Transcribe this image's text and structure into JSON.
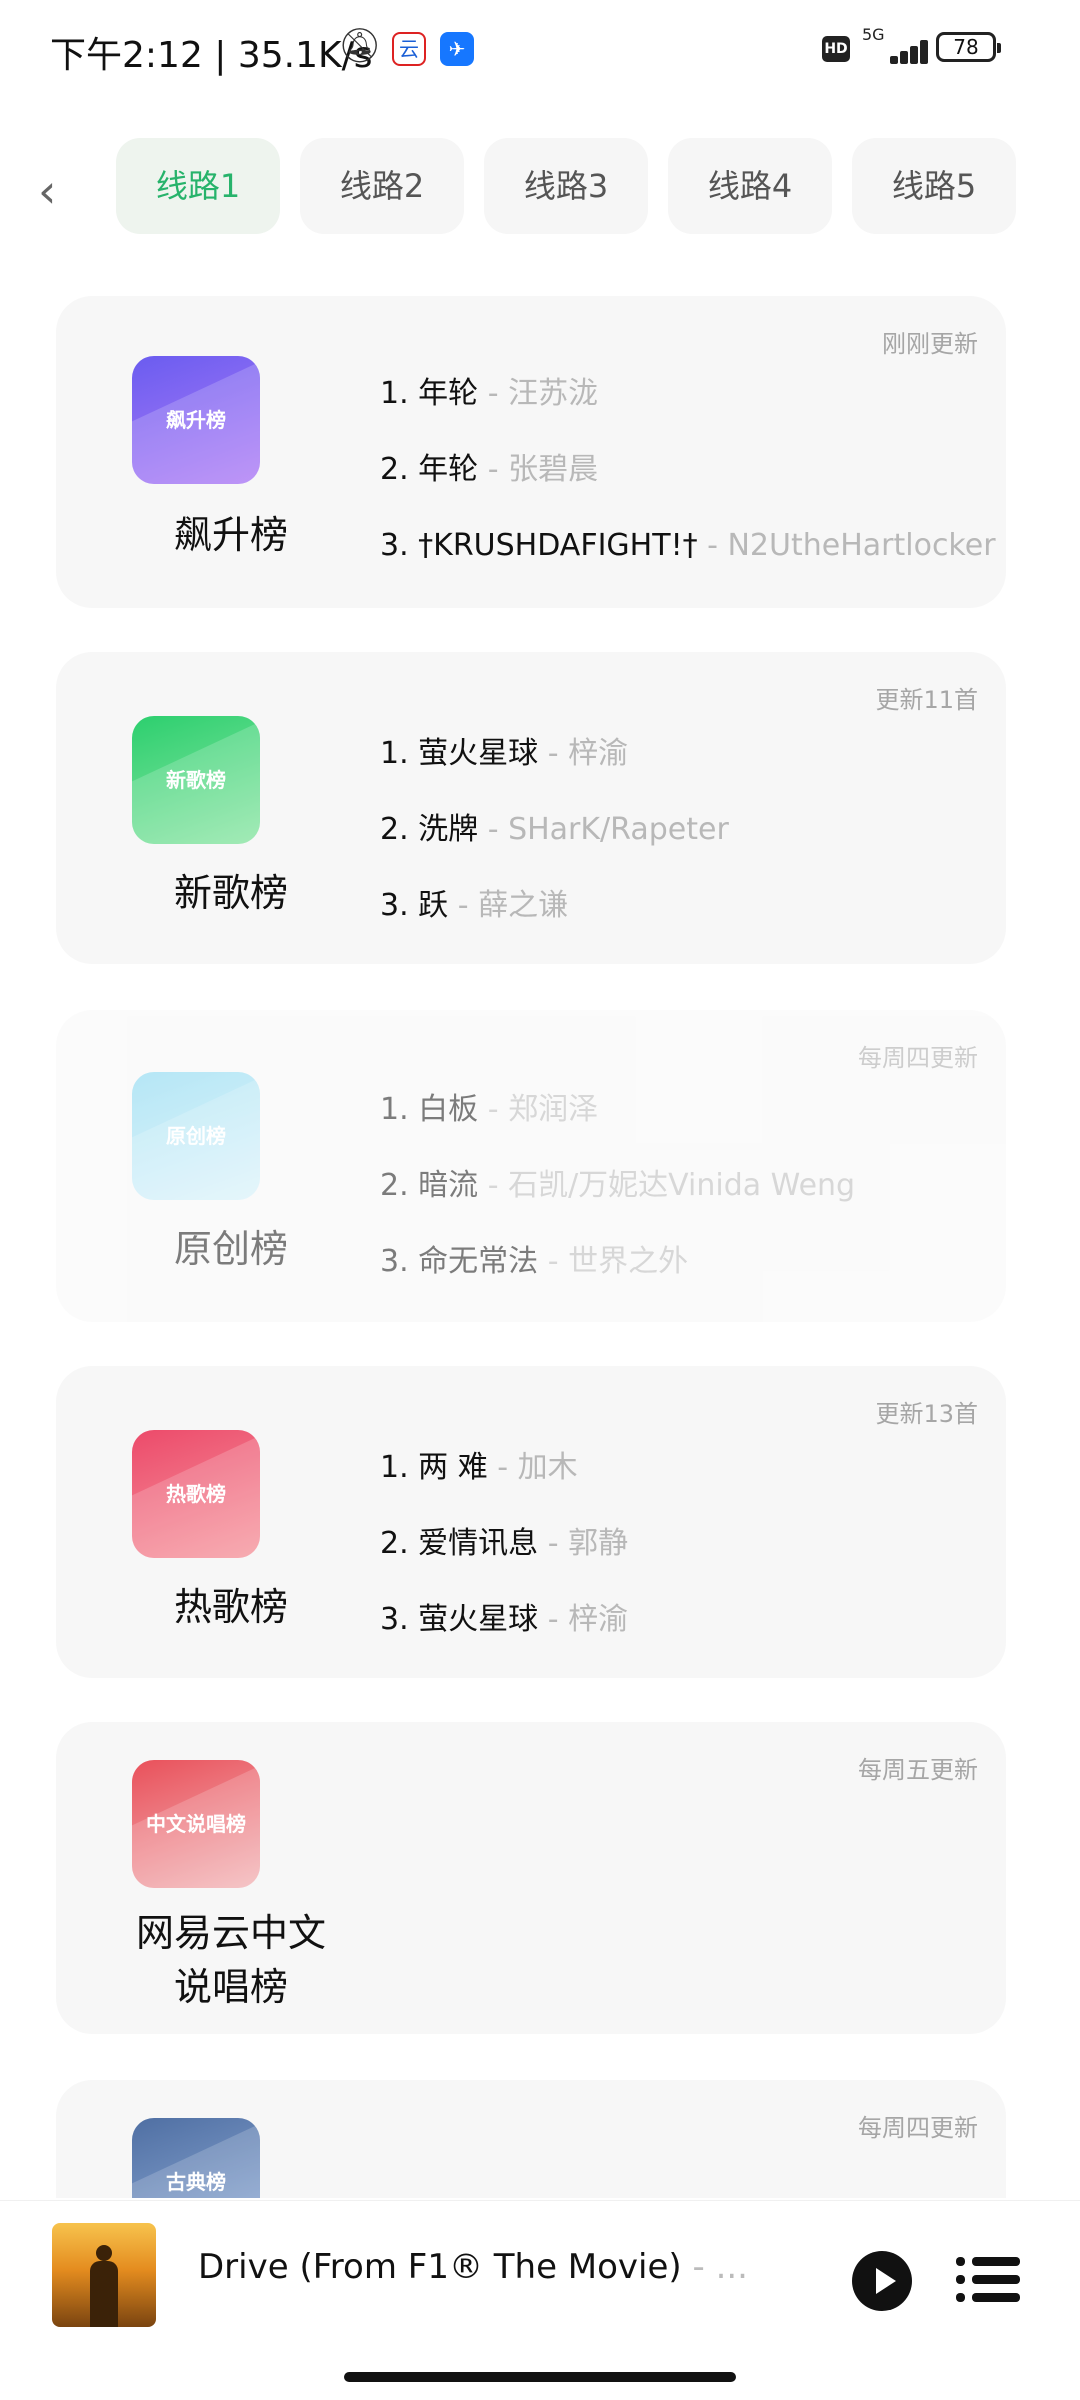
{
  "status_bar": {
    "time": "下午2:12 | 35.1K/s",
    "hd": "HD",
    "network": "5G",
    "battery": "78"
  },
  "tabs": [
    {
      "label": "线路1",
      "active": true
    },
    {
      "label": "线路2",
      "active": false
    },
    {
      "label": "线路3",
      "active": false
    },
    {
      "label": "线路4",
      "active": false
    },
    {
      "label": "线路5",
      "active": false
    }
  ],
  "charts": [
    {
      "name": "飙升榜",
      "cover_label": "飙升榜",
      "update": "刚刚更新",
      "cover_colors": [
        "#6a5cf0",
        "#b07ef6"
      ],
      "songs": [
        {
          "title": "1. 年轮",
          "artist": " - 汪苏泷"
        },
        {
          "title": "2. 年轮",
          "artist": " - 张碧晨"
        },
        {
          "title": "3. †KRUSHDAFIGHT!†",
          "artist": " - N2UtheHartlocker"
        }
      ]
    },
    {
      "name": "新歌榜",
      "cover_label": "新歌榜",
      "update": "更新11首",
      "cover_colors": [
        "#2ccf6e",
        "#8fe6a7"
      ],
      "songs": [
        {
          "title": "1. 萤火星球",
          "artist": " - 梓渝"
        },
        {
          "title": "2. 洗牌",
          "artist": " - SHarK/Rapeter"
        },
        {
          "title": "3. 跃",
          "artist": " - 薛之谦"
        }
      ]
    },
    {
      "name": "原创榜",
      "cover_label": "原创榜",
      "update": "每周四更新",
      "cover_colors": [
        "#79d3ef",
        "#c7ecf7"
      ],
      "songs": [
        {
          "title": "1. 白板",
          "artist": " - 郑润泽"
        },
        {
          "title": "2. 暗流",
          "artist": " - 石凯/万妮达Vinida Weng"
        },
        {
          "title": "3. 命无常法",
          "artist": " - 世界之外"
        }
      ]
    },
    {
      "name": "热歌榜",
      "cover_label": "热歌榜",
      "update": "更新13首",
      "cover_colors": [
        "#ec4a6a",
        "#f69aa1"
      ],
      "songs": [
        {
          "title": "1. 两 难",
          "artist": " - 加木"
        },
        {
          "title": "2. 爱情讯息",
          "artist": " - 郭静"
        },
        {
          "title": "3. 萤火星球",
          "artist": " - 梓渝"
        }
      ]
    },
    {
      "name": "网易云中文\n说唱榜",
      "cover_label": "中文说唱榜",
      "update": "每周五更新",
      "cover_colors": [
        "#e9505a",
        "#f3b9bb"
      ],
      "songs": []
    },
    {
      "name": "",
      "cover_label": "古典榜",
      "update": "每周四更新",
      "cover_colors": [
        "#4f6fa3",
        "#7f9cc9"
      ],
      "songs": []
    }
  ],
  "player": {
    "title": "Drive (From F1® The Movie)",
    "more": " - ..."
  }
}
